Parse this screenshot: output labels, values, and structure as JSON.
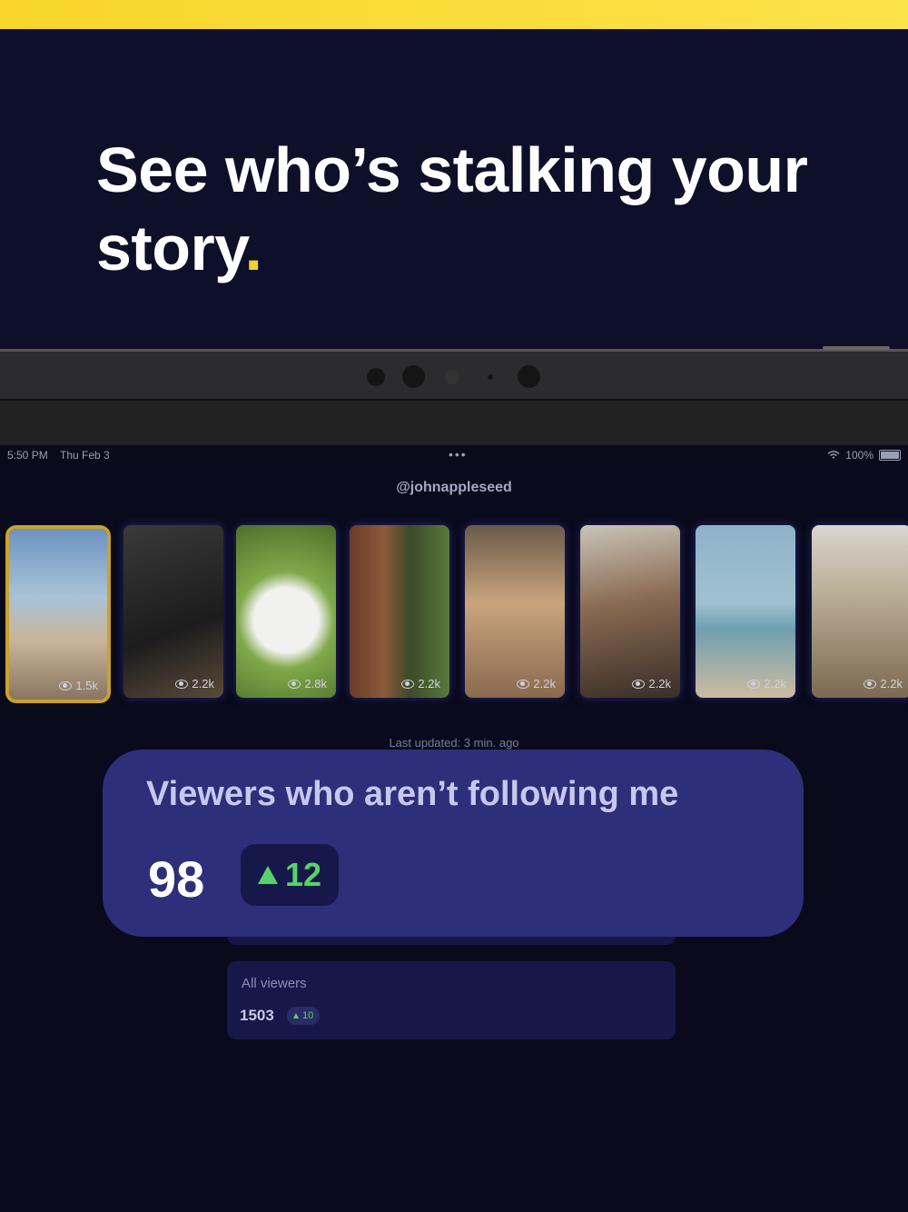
{
  "headline": {
    "text": "See who’s stalking your story",
    "dot": "."
  },
  "status": {
    "time": "5:50 PM",
    "date": "Thu Feb 3",
    "dots": "•••",
    "battery": "100%"
  },
  "profile": {
    "username": "@johnappleseed"
  },
  "stories": [
    {
      "views": "1.5k",
      "bg": "linear-gradient(180deg,#6d93c1 0%,#a9c2d6 40%,#c8b59a 65%,#8a7660 100%)"
    },
    {
      "views": "2.2k",
      "bg": "linear-gradient(160deg,#3a3a3a,#1c1c1c 60%,#5a4a3a)"
    },
    {
      "views": "2.8k",
      "bg": "radial-gradient(circle at 50% 55%,#f1f1ef 0 30%,#7fa94a 45%,#4d6e2a 100%)"
    },
    {
      "views": "2.2k",
      "bg": "linear-gradient(90deg,#6b3b2a 0%,#8c5a3b 35%,#3c4a2a 60%,#587a3a 100%)"
    },
    {
      "views": "2.2k",
      "bg": "linear-gradient(180deg,#6a5a4a 0%,#c9a47e 45%,#8a6a4e 100%)"
    },
    {
      "views": "2.2k",
      "bg": "linear-gradient(170deg,#c9c4b8 0%,#8a6a52 45%,#3a2e28 100%)"
    },
    {
      "views": "2.2k",
      "bg": "linear-gradient(180deg,#8fb2c9 0%,#9fc1cf 45%,#6f9fb0 60%,#cdbba0 100%)"
    },
    {
      "views": "2.2k",
      "bg": "linear-gradient(180deg,#d9d6cf 0%,#b9ad96 40%,#7c6a52 100%)"
    }
  ],
  "updated": "Last updated: 3 min. ago",
  "not_following": {
    "title": "Viewers who aren’t following me",
    "count": "98",
    "change": "12"
  },
  "all_viewers": {
    "label": "All viewers",
    "count": "1503",
    "change": "10"
  },
  "colors": {
    "accent": "#f5cf2c",
    "card": "#2d2f7a",
    "positive": "#55d36a"
  }
}
